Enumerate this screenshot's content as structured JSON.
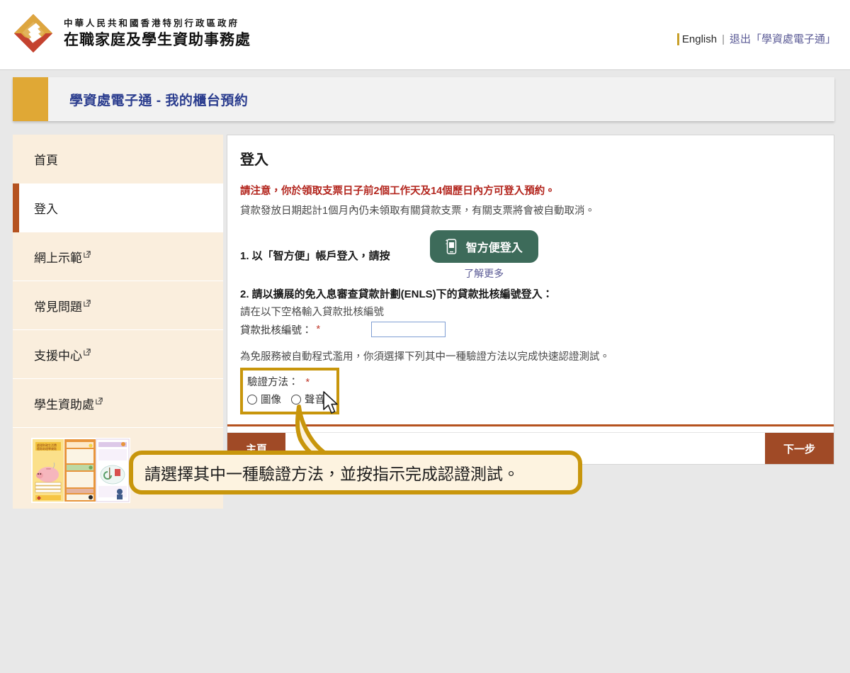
{
  "header": {
    "org_line1": "中華人民共和國香港特別行政區政府",
    "org_line2": "在職家庭及學生資助事務處",
    "logo_icon": "wfsfaa-diamond-logo",
    "language_link": "English",
    "separator": "|",
    "logout_link": "退出「學資處電子通」"
  },
  "title_bar": {
    "title": "學資處電子通 - 我的櫃台預約"
  },
  "sidebar": {
    "items": [
      {
        "label": "首頁",
        "external": false,
        "active": false
      },
      {
        "label": "登入",
        "external": false,
        "active": true
      },
      {
        "label": "網上示範",
        "external": true,
        "active": false
      },
      {
        "label": "常見問題",
        "external": true,
        "active": false
      },
      {
        "label": "支援中心",
        "external": true,
        "active": false
      },
      {
        "label": "學生資助處",
        "external": true,
        "active": false
      }
    ],
    "external_icon": "external-link-icon",
    "leaflet_alt": "學生資助宣傳單張"
  },
  "main": {
    "heading": "登入",
    "notice_warning": "請注意，你於領取支票日子前2個工作天及14個歷日內方可登入預約。",
    "notice_info": "貸款發放日期起計1個月內仍未領取有關貸款支票，有關支票將會被自動取消。",
    "step1": {
      "label": "1. 以「智方便」帳戶登入，請按",
      "button_label": "智方便登入",
      "button_icon": "smartphone-icon",
      "button_color": "#3d6b5a",
      "learn_more": "了解更多"
    },
    "step2": {
      "title": "2. 請以擴展的免入息審查貸款計劃(ENLS)下的貸款批核編號登入：",
      "hint": "請在以下空格輸入貸款批核編號",
      "field_label": "貸款批核編號：",
      "required_mark": "*",
      "field_value": "",
      "field_placeholder": ""
    },
    "verification": {
      "abuse_note": "為免服務被自動程式濫用，你須選擇下列其中一種驗證方法以完成快速認證測試。",
      "label": "驗證方法：",
      "required_mark": "*",
      "options": [
        {
          "label": "圖像",
          "selected": false
        },
        {
          "label": "聲音",
          "selected": false
        }
      ],
      "highlight_color": "#c8960c"
    },
    "buttons": {
      "home": "主頁",
      "next": "下一步",
      "button_color": "#a04a26"
    }
  },
  "annotation": {
    "callout_text": "請選擇其中一種驗證方法，並按指示完成認證測試。",
    "callout_border_color": "#c8960c",
    "callout_fill_color": "#fdf3e0",
    "cursor_icon": "mouse-pointer-arrow"
  }
}
